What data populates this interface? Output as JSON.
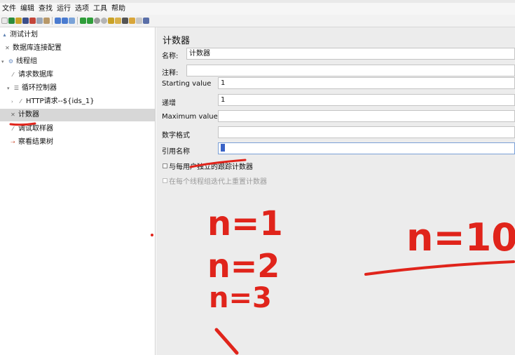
{
  "menu": [
    "文件",
    "编辑",
    "查找",
    "运行",
    "选项",
    "工具",
    "帮助"
  ],
  "toolbar_icons": [
    "new-icon",
    "templates-icon",
    "open-icon",
    "save-icon",
    "cut-icon",
    "copy-icon",
    "paste-icon",
    "expand-icon",
    "collapse-icon",
    "toggle-icon",
    "start-icon",
    "start-no-pause-icon",
    "stop-icon",
    "shutdown-icon",
    "remote-start-icon",
    "clear-icon",
    "clear-all-icon",
    "search-icon",
    "reset-search-icon",
    "function-helper-icon",
    "help-icon"
  ],
  "tree": {
    "items": [
      {
        "label": "测试计划",
        "icon": "test-plan-icon"
      },
      {
        "label": "数据库连接配置",
        "icon": "config-icon"
      },
      {
        "label": "线程组",
        "icon": "thread-group-icon"
      },
      {
        "label": "请求数据库",
        "icon": "sampler-icon"
      },
      {
        "label": "循环控制器",
        "icon": "loop-controller-icon"
      },
      {
        "label": "HTTP请求--${ids_1}",
        "icon": "sampler-icon"
      },
      {
        "label": "计数器",
        "icon": "counter-icon"
      },
      {
        "label": "调试取样器",
        "icon": "sampler-icon"
      },
      {
        "label": "察看结果树",
        "icon": "listener-icon"
      }
    ]
  },
  "panel": {
    "title": "计数器",
    "name_label": "名称:",
    "name_value": "计数器",
    "comment_label": "注释:",
    "comment_value": "",
    "start_label": "Starting value",
    "start_value": "1",
    "increment_label": "递增",
    "increment_value": "1",
    "max_label": "Maximum value",
    "max_value": "",
    "format_label": "数字格式",
    "format_value": "",
    "ref_label": "引用名称",
    "ref_value": "",
    "chk_per_user": "与每用户独立的跟踪计数器",
    "chk_reset": "在每个线程组迭代上重置计数器"
  },
  "annotations": {
    "n1": "n=1",
    "n2": "n=2",
    "n3": "n=3",
    "n10": "n=10",
    "ink_color": "#e0241b"
  },
  "colors": {
    "selection": "#d7d7d7",
    "panel_bg": "#ececec",
    "focus_border": "#7aa0d6"
  }
}
